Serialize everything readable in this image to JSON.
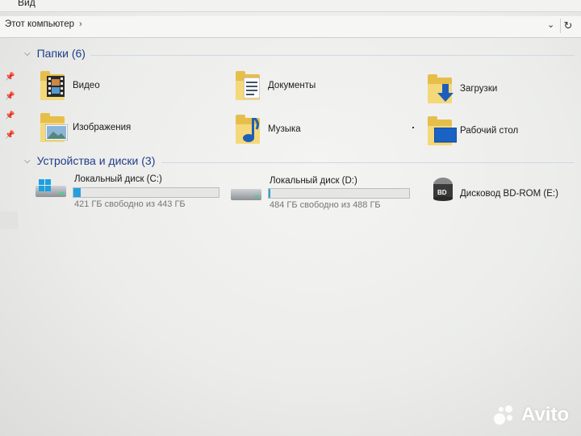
{
  "menu": {
    "view": "Вид"
  },
  "address": {
    "path": "Этот компьютер",
    "separator": "›",
    "dropdown": "⌄",
    "refresh": "↻"
  },
  "folders_section": {
    "title": "Папки (6)"
  },
  "folders": [
    {
      "label": "Видео",
      "icon": "video-folder-icon"
    },
    {
      "label": "Документы",
      "icon": "documents-folder-icon"
    },
    {
      "label": "Загрузки",
      "icon": "downloads-folder-icon"
    },
    {
      "label": "Изображения",
      "icon": "pictures-folder-icon"
    },
    {
      "label": "Музыка",
      "icon": "music-folder-icon"
    },
    {
      "label": "Рабочий стол",
      "icon": "desktop-folder-icon"
    }
  ],
  "devices_section": {
    "title": "Устройства и диски (3)"
  },
  "drives": [
    {
      "label": "Локальный диск (C:)",
      "free": "421 ГБ свободно из 443 ГБ",
      "used_fraction": 0.05
    },
    {
      "label": "Локальный диск (D:)",
      "free": "484 ГБ свободно из 488 ГБ",
      "used_fraction": 0.01
    },
    {
      "label": "Дисковод BD-ROM (E:)",
      "badge": "BD"
    }
  ],
  "watermark": "Avito",
  "colors": {
    "accent": "#26a0da",
    "section_title": "#1f3d8a",
    "folder": "#e6be4a"
  }
}
